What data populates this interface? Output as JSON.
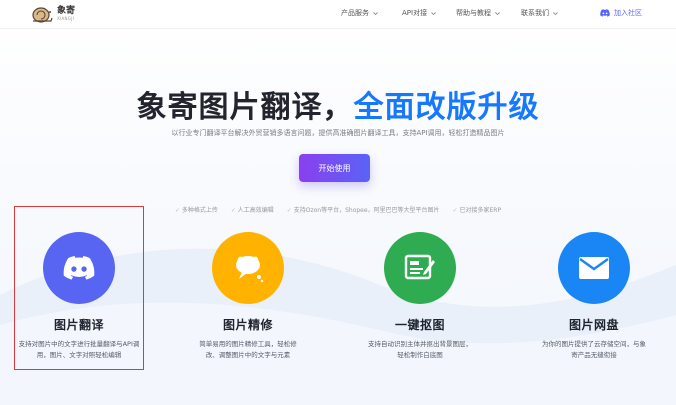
{
  "brand": {
    "name": "象寄",
    "subtitle": "XIANGJI"
  },
  "nav": {
    "items": [
      "产品服务",
      "API对接",
      "帮助与教程",
      "联系我们"
    ],
    "discord_label": "加入社区"
  },
  "hero": {
    "title_main": "象寄图片翻译，",
    "title_accent": "全面改版升级",
    "subtitle": "以行业专门翻译平台解决外贸营销多语言问题，提供高准确图片翻译工具，支持API调用，轻松打造精品图片",
    "cta_label": "开始使用",
    "features": [
      "多种格式上传",
      "人工高效编辑",
      "支持Ozon等平台，Shopee，阿里巴巴等大型平台图片",
      "已对接多家ERP"
    ]
  },
  "cards": [
    {
      "title": "图片翻译",
      "desc_line1": "支持对图片中的文字进行批量翻译与API调",
      "desc_line2": "用，图片、文字对照轻松编辑",
      "icon": "discord-icon",
      "color": "#5865f2"
    },
    {
      "title": "图片精修",
      "desc_line1": "简单易用的图片精修工具，轻松修",
      "desc_line2": "改、调整图片中的文字与元素",
      "icon": "chat-bubble-icon",
      "color": "#ffb300"
    },
    {
      "title": "一键抠图",
      "desc_line1": "支持自动识别主体并抠出背景图层，",
      "desc_line2": "轻松制作白底图",
      "icon": "image-edit-icon",
      "color": "#2fab52"
    },
    {
      "title": "图片网盘",
      "desc_line1": "为你的图片提供了云存储空间，与象",
      "desc_line2": "寄产品无缝衔接",
      "icon": "mail-icon",
      "color": "#1a86f5"
    }
  ]
}
